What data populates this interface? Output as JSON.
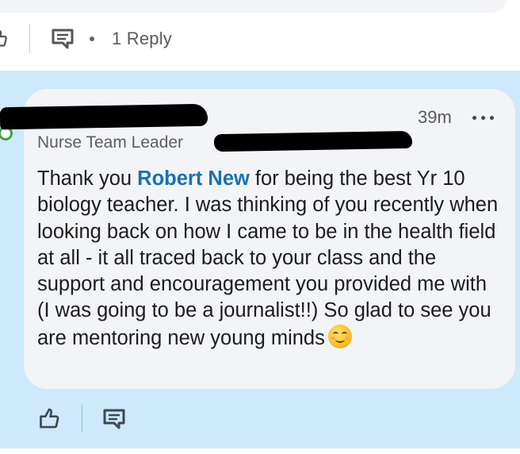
{
  "previous_comment": {
    "actions": {
      "reply_count_label": "1 Reply"
    }
  },
  "comment": {
    "timestamp": "39m",
    "headline": "Nurse Team Leader",
    "body": {
      "before_mention": "Thank you ",
      "mention": "Robert New",
      "after_mention": " for being the best Yr 10 biology teacher. I was thinking of you recently when looking back on how I came to be in the health field at all - it all traced back to your class and the support and encouragement you provided me with (I was going to be a journalist!!) So glad to see you are mentoring new young minds"
    },
    "emoji": "smiling-face-icon",
    "author_name_redacted": true,
    "organization_redacted": true,
    "presence_status": "online"
  },
  "icons": {
    "like": "thumbs-up-icon",
    "comment": "comment-icon",
    "more": "more-options-icon"
  },
  "colors": {
    "thread_highlight": "#cde9fb",
    "bubble": "#f2f4f7",
    "mention": "#1b70b1",
    "presence": "#3fa34d"
  }
}
